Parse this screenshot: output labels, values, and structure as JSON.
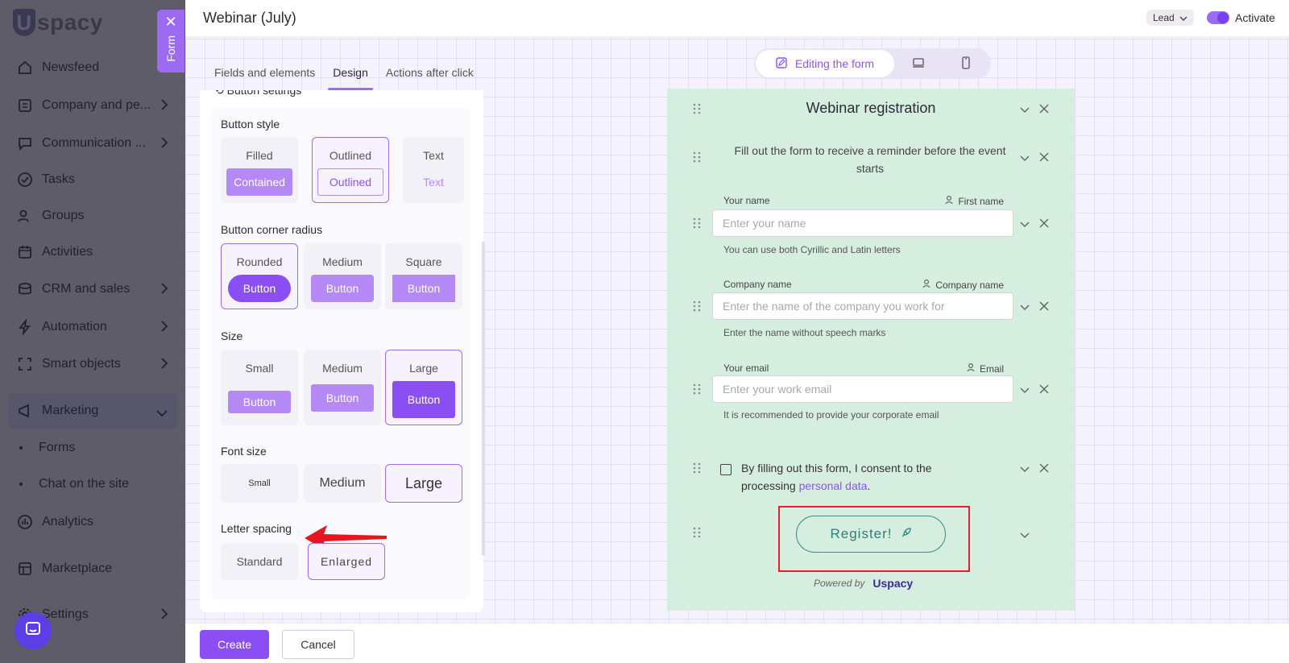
{
  "sidebar": {
    "logo": "spacy",
    "items": [
      {
        "label": "Newsfeed",
        "icon": "home-icon",
        "chevron": false
      },
      {
        "label": "Company and pe...",
        "icon": "building-icon",
        "chevron": true
      },
      {
        "label": "Communication ...",
        "icon": "chat-icon",
        "chevron": true
      },
      {
        "label": "Tasks",
        "icon": "check-circle-icon",
        "chevron": false
      },
      {
        "label": "Groups",
        "icon": "users-icon",
        "chevron": false
      },
      {
        "label": "Activities",
        "icon": "calendar-icon",
        "chevron": false
      },
      {
        "label": "CRM and sales",
        "icon": "coins-icon",
        "chevron": true
      },
      {
        "label": "Automation",
        "icon": "lightning-icon",
        "chevron": true
      },
      {
        "label": "Smart objects",
        "icon": "smart-object-icon",
        "chevron": true
      },
      {
        "label": "Marketing",
        "icon": "marketing-icon",
        "chevron": true
      },
      {
        "label": "Analytics",
        "icon": "analytics-icon",
        "chevron": false
      },
      {
        "label": "Marketplace",
        "icon": "store-icon",
        "chevron": false
      },
      {
        "label": "Settings",
        "icon": "gear-icon",
        "chevron": true
      }
    ],
    "sub_items": [
      "Forms",
      "Chat on the site"
    ]
  },
  "form_tab": {
    "label": "Form"
  },
  "header": {
    "title": "Webinar (July)",
    "lead_label": "Lead",
    "activate_label": "Activate"
  },
  "tabs": [
    "Fields and elements",
    "Design",
    "Actions after click"
  ],
  "panel": {
    "cut_heading": "Button settings",
    "button_style": {
      "label": "Button style",
      "options": [
        {
          "label": "Filled",
          "preview": "Contained"
        },
        {
          "label": "Outlined",
          "preview": "Outlined"
        },
        {
          "label": "Text",
          "preview": "Text"
        }
      ]
    },
    "corner_radius": {
      "label": "Button corner radius",
      "options": [
        {
          "label": "Rounded",
          "preview": "Button"
        },
        {
          "label": "Medium",
          "preview": "Button"
        },
        {
          "label": "Square",
          "preview": "Button"
        }
      ]
    },
    "size": {
      "label": "Size",
      "options": [
        {
          "label": "Small",
          "preview": "Button"
        },
        {
          "label": "Medium",
          "preview": "Button"
        },
        {
          "label": "Large",
          "preview": "Button"
        }
      ]
    },
    "font_size": {
      "label": "Font size",
      "options": [
        "Small",
        "Medium",
        "Large"
      ]
    },
    "letter_spacing": {
      "label": "Letter spacing",
      "options": [
        "Standard",
        "Enlarged"
      ]
    }
  },
  "preview_toggle": {
    "edit_label": "Editing the form"
  },
  "form_preview": {
    "title": "Webinar registration",
    "description": "Fill out the form to receive a reminder before the event starts",
    "fields": [
      {
        "label": "Your name",
        "mapping": "First name",
        "placeholder": "Enter your name",
        "hint": "You can use both Cyrillic and Latin letters"
      },
      {
        "label": "Company name",
        "mapping": "Company name",
        "placeholder": "Enter the name of the company you work for",
        "hint": "Enter the name without speech marks"
      },
      {
        "label": "Your email",
        "mapping": "Email",
        "placeholder": "Enter your work email",
        "hint": "It is recommended to provide your corporate email"
      }
    ],
    "consent_text": "By filling out this form, I consent to the processing",
    "consent_link": "personal data",
    "consent_end": ".",
    "register_label": "Register!",
    "powered_by": "Powered by",
    "brand": "spacy"
  },
  "footer": {
    "create_label": "Create",
    "cancel_label": "Cancel"
  }
}
